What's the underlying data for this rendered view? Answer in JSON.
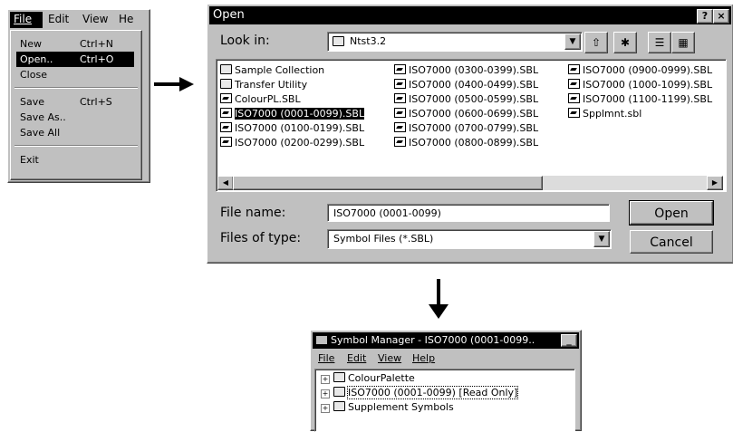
{
  "file_menu": {
    "menubar": [
      "File",
      "Edit",
      "View",
      "He"
    ],
    "items": [
      {
        "label": "New",
        "accel": "Ctrl+N"
      },
      {
        "label": "Open..",
        "accel": "Ctrl+O"
      },
      {
        "label": "Close",
        "accel": ""
      },
      {
        "label": "Save",
        "accel": "Ctrl+S"
      },
      {
        "label": "Save As..",
        "accel": ""
      },
      {
        "label": "Save All",
        "accel": ""
      },
      {
        "label": "Exit",
        "accel": ""
      }
    ]
  },
  "open_dialog": {
    "title": "Open",
    "help": "?",
    "close": "×",
    "look_in_label": "Look in:",
    "look_in_value": "Ntst3.2",
    "files": [
      {
        "name": "Sample Collection",
        "icon": "folder-icon"
      },
      {
        "name": "Transfer Utility",
        "icon": "folder-icon"
      },
      {
        "name": "ColourPL.SBL",
        "icon": "document-icon"
      },
      {
        "name": "ISO7000  (0001-0099).SBL",
        "icon": "document-icon"
      },
      {
        "name": "ISO7000  (0100-0199).SBL",
        "icon": "document-icon"
      },
      {
        "name": "ISO7000  (0200-0299).SBL",
        "icon": "document-icon"
      },
      {
        "name": "ISO7000  (0300-0399).SBL",
        "icon": "document-icon"
      },
      {
        "name": "ISO7000  (0400-0499).SBL",
        "icon": "document-icon"
      },
      {
        "name": "ISO7000  (0500-0599).SBL",
        "icon": "document-icon"
      },
      {
        "name": "ISO7000  (0600-0699).SBL",
        "icon": "document-icon"
      },
      {
        "name": "ISO7000  (0700-0799).SBL",
        "icon": "document-icon"
      },
      {
        "name": "ISO7000  (0800-0899).SBL",
        "icon": "document-icon"
      },
      {
        "name": "ISO7000  (0900-0999).SBL",
        "icon": "document-icon"
      },
      {
        "name": "ISO7000  (1000-1099).SBL",
        "icon": "document-icon"
      },
      {
        "name": "ISO7000  (1100-1199).SBL",
        "icon": "document-icon"
      },
      {
        "name": "Spplmnt.sbl",
        "icon": "document-icon"
      }
    ],
    "selected_file": "ISO7000  (0001-0099).SBL",
    "file_name_label": "File name:",
    "file_name_value": "ISO7000  (0001-0099)",
    "files_of_type_label": "Files of type:",
    "files_of_type_value": "Symbol Files (*.SBL)",
    "open_button": "Open",
    "cancel_button": "Cancel"
  },
  "symbol_manager": {
    "title": "Symbol Manager - ISO7000  (0001-0099..",
    "menubar": [
      "File",
      "Edit",
      "View",
      "Help"
    ],
    "tree": [
      "ColourPalette",
      "ISO7000  (0001-0099) [Read Only]",
      "Supplement Symbols"
    ]
  }
}
